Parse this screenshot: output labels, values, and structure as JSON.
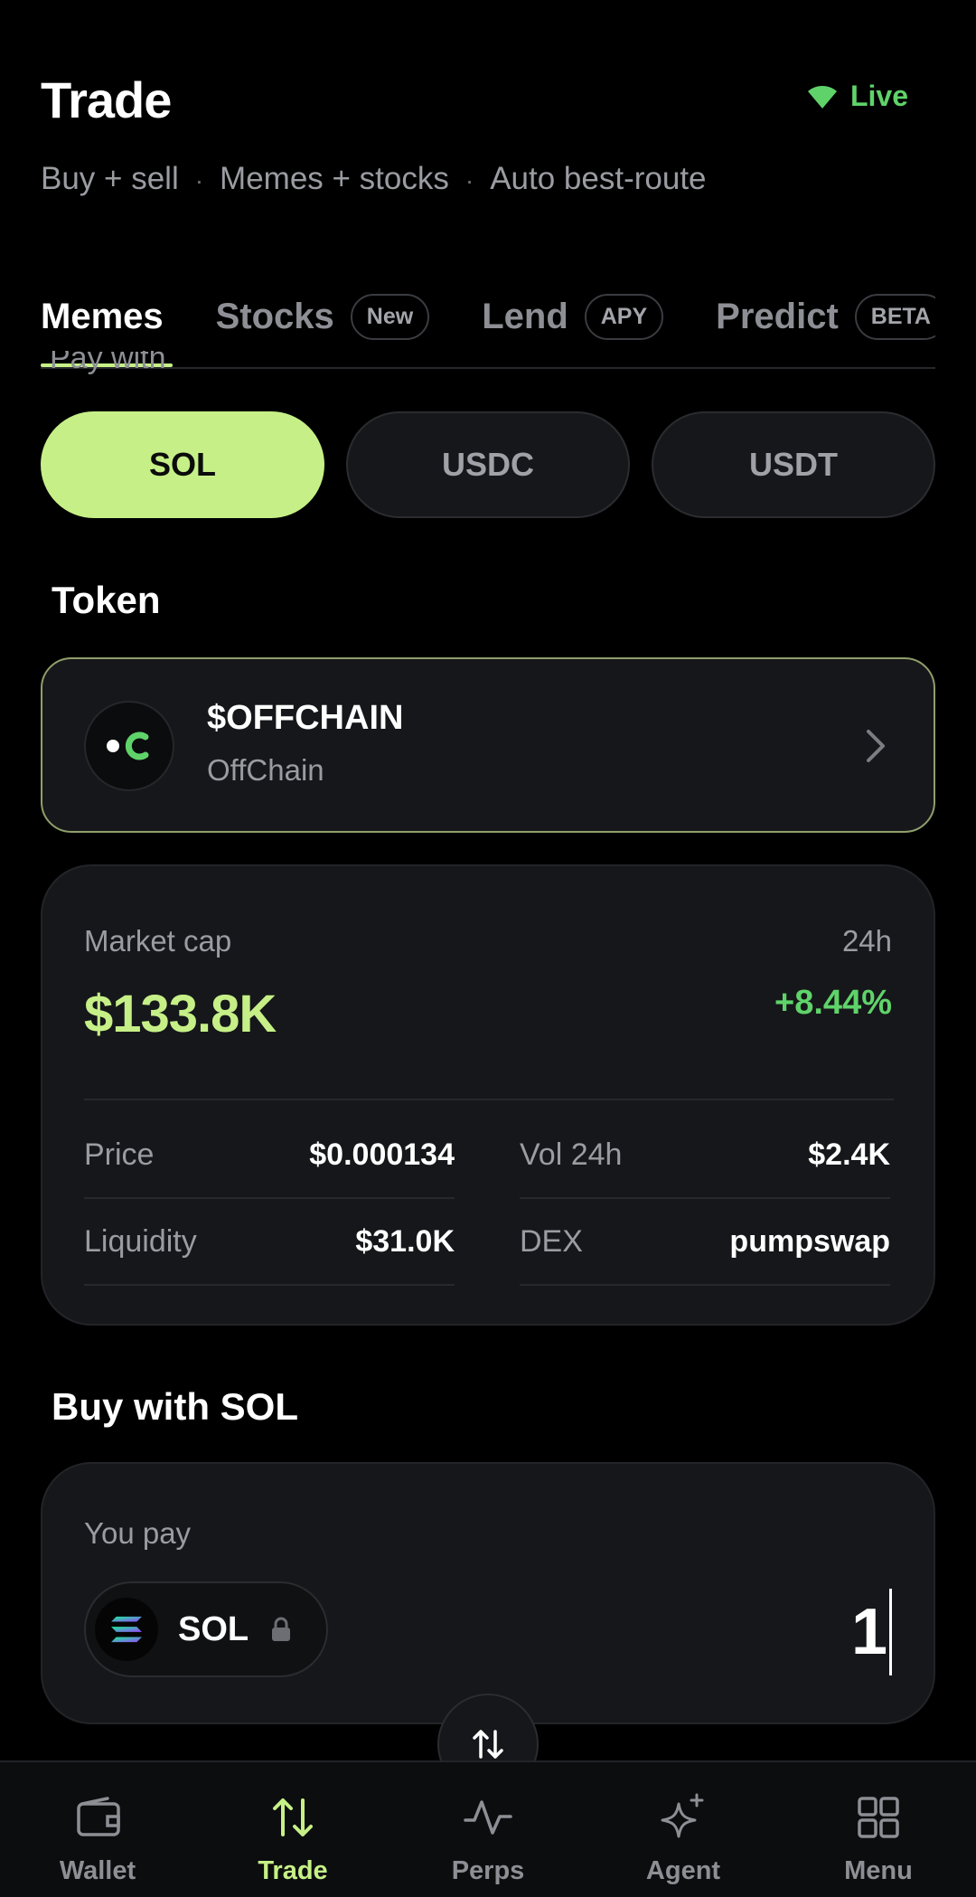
{
  "header": {
    "title": "Trade",
    "live_label": "Live",
    "subtitle_parts": [
      "Buy + sell",
      "Memes + stocks",
      "Auto best-route"
    ]
  },
  "tabs": [
    {
      "label": "Memes",
      "badge": ""
    },
    {
      "label": "Stocks",
      "badge": "New"
    },
    {
      "label": "Lend",
      "badge": "APY"
    },
    {
      "label": "Predict",
      "badge": "BETA"
    }
  ],
  "pay_with_hint": "Pay with",
  "currencies": [
    "SOL",
    "USDC",
    "USDT"
  ],
  "token_section": {
    "title": "Token",
    "symbol": "$OFFCHAIN",
    "name": "OffChain"
  },
  "stats": {
    "market_cap_label": "Market cap",
    "period": "24h",
    "market_cap_value": "$133.8K",
    "change": "+8.44%",
    "price_label": "Price",
    "price_value": "$0.000134",
    "vol_label": "Vol 24h",
    "vol_value": "$2.4K",
    "liquidity_label": "Liquidity",
    "liquidity_value": "$31.0K",
    "dex_label": "DEX",
    "dex_value": "pumpswap"
  },
  "buy_section": {
    "title": "Buy with SOL",
    "you_pay_label": "You pay",
    "token": "SOL",
    "amount": "1"
  },
  "nav": [
    "Wallet",
    "Trade",
    "Perps",
    "Agent",
    "Menu"
  ],
  "colors": {
    "accent": "#c6f087",
    "positive": "#5fd36a",
    "background": "#000000",
    "card": "#16171a"
  }
}
